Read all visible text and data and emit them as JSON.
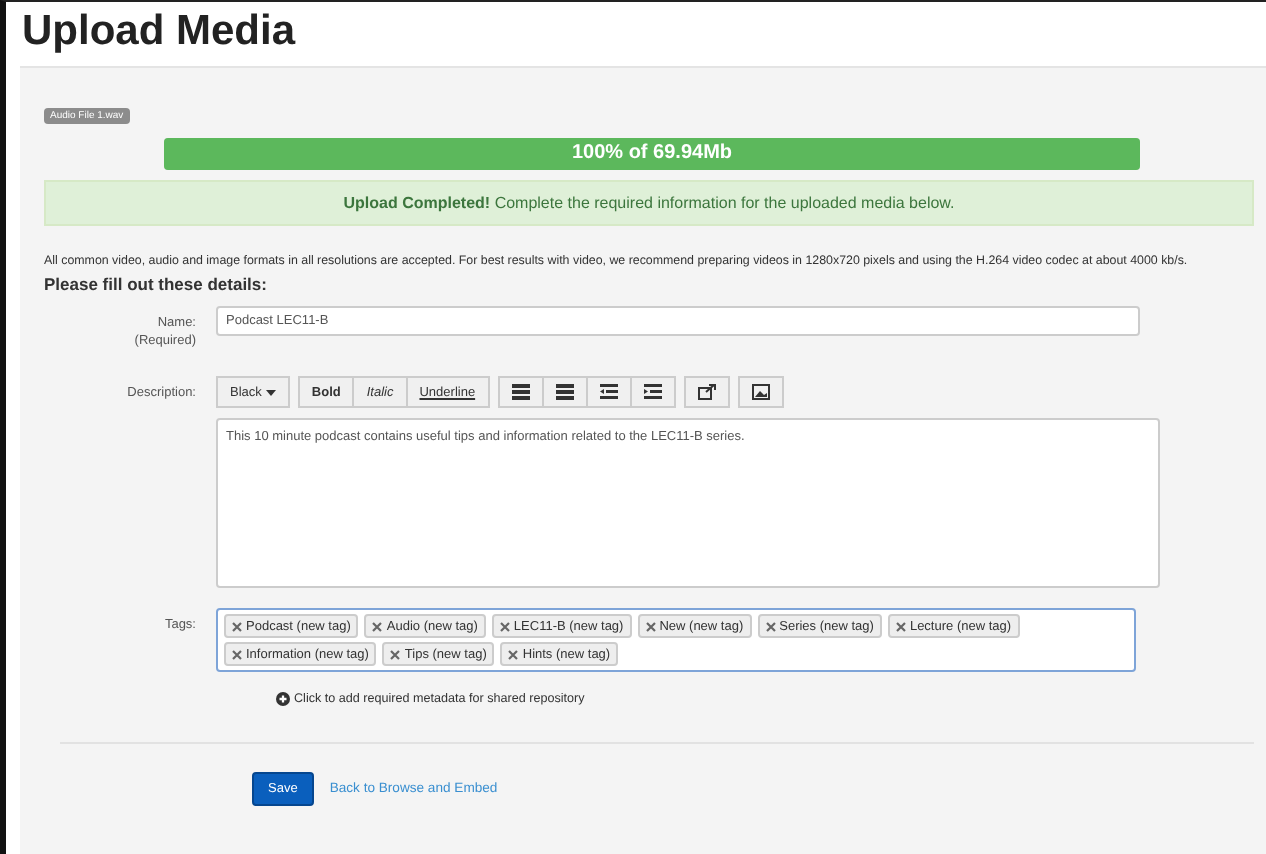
{
  "title": "Upload Media",
  "file_badge": "Audio File 1.wav",
  "progress": {
    "level": 1,
    "text": "100% of 69.94Mb"
  },
  "alert": "**Upload Completed!** Complete the required information for the uploaded media below.",
  "info": "All common video, audio and image formats in all resolutions are accepted.  For best results with video, we recommend preparing videos in 1280x720 pixels and using the H.264 video codec at about 4000 kb/s.",
  "section_title": "Please fill out these details:",
  "name_field": {
    "label": "Name:",
    "sublabel": "(Required)",
    "value": "Podcast LEC11-B"
  },
  "description": {
    "label": "Description:",
    "toolbar": [
      {
        "kind": "dropdown",
        "text": "Black"
      },
      {
        "kind": "bold",
        "text": "Bold"
      },
      {
        "kind": "italic",
        "text": "Italic"
      },
      {
        "kind": "underline",
        "text": "Underline"
      },
      {
        "kind": "list"
      },
      {
        "kind": "list"
      },
      {
        "kind": "outdent"
      },
      {
        "kind": "indent"
      },
      {
        "kind": "share"
      },
      {
        "kind": "image"
      }
    ],
    "value": "This 10 minute podcast contains useful tips and information related to the LEC11-B series."
  },
  "tags": {
    "label": "Tags:",
    "items": [
      "Podcast (new tag)",
      "Audio (new tag)",
      "LEC11-B (new tag)",
      "New (new tag)",
      "Series (new tag)",
      "Lecture (new tag)",
      "Information (new tag)",
      "Tips (new tag)",
      "Hints (new tag)"
    ]
  },
  "metadata_link": "Click to add required metadata for shared repository",
  "save_button": "Save",
  "back_link": "Back to Browse and Embed"
}
